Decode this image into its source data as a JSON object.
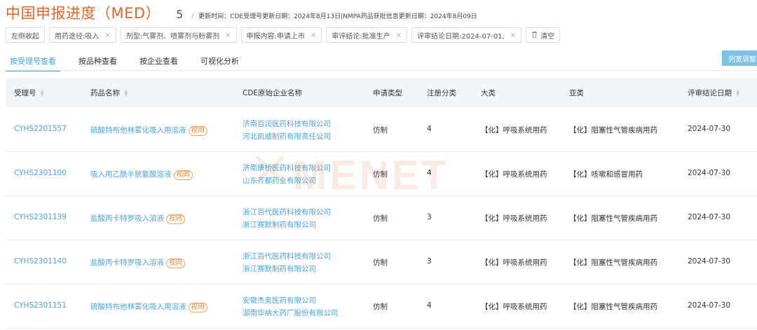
{
  "header": {
    "title": "中国申报进度（MED）",
    "count": "5",
    "separator": "/",
    "update_text": "更新时间：CDE受理号更新日期：2024年8月13日|NMPA药品获批信息更新日期：2024年8月09日"
  },
  "filters": {
    "collapse": "左侧收起",
    "chips": [
      {
        "label": "用药途径:吸入"
      },
      {
        "label": "剂型:气雾剂、喷雾剂与粉雾剂"
      },
      {
        "label": "申报内容:申请上市"
      },
      {
        "label": "审评结论:批准生产"
      },
      {
        "label": "评审结论日期:2024-07-01,"
      }
    ],
    "clear": "清空",
    "close_glyph": "×"
  },
  "tabs": [
    "按受理号查看",
    "按品种查看",
    "按企业查看",
    "可视化分析"
  ],
  "column_adjust_label": "列宽调整",
  "watermark_text": "MENET",
  "table": {
    "headers": {
      "acceptance_no": "受理号",
      "drug_name": "药品名称",
      "company": "CDE原始企业名称",
      "app_type": "申请类型",
      "reg_class": "注册分类",
      "category": "大类",
      "subcategory": "亚类",
      "review_date": "评审结论日期"
    },
    "rows": [
      {
        "acceptance_no": "CYHS2201557",
        "drug_name": "硫酸特布他林雾化吸入用溶液",
        "badge": "视同",
        "companies": [
          "济南百润医药科技有限公司",
          "河北凯威制药有限责任公司"
        ],
        "app_type": "仿制",
        "reg_class": "4",
        "category": "【化】呼吸系统用药",
        "subcategory": "【化】阻塞性气管疾病用药",
        "review_date": "2024-07-30"
      },
      {
        "acceptance_no": "CYHS2301100",
        "drug_name": "吸入用乙酰半胱氨酸溶液",
        "badge": "视同",
        "companies": [
          "济南康桥医药科技有限公司",
          "山东齐都药业有限公司"
        ],
        "app_type": "仿制",
        "reg_class": "4",
        "category": "【化】呼吸系统用药",
        "subcategory": "【化】咳嗽和感冒用药",
        "review_date": "2024-07-30"
      },
      {
        "acceptance_no": "CYHS2301139",
        "drug_name": "盐酸丙卡特罗吸入溶液",
        "badge": "视同",
        "companies": [
          "浙江百代医药科技有限公司",
          "浙江赛默制药有限公司"
        ],
        "app_type": "仿制",
        "reg_class": "3",
        "category": "【化】呼吸系统用药",
        "subcategory": "【化】阻塞性气管疾病用药",
        "review_date": "2024-07-30"
      },
      {
        "acceptance_no": "CYHS2301140",
        "drug_name": "盐酸丙卡特罗吸入溶液",
        "badge": "视同",
        "companies": [
          "浙江百代医药科技有限公司",
          "浙江赛默制药有限公司"
        ],
        "app_type": "仿制",
        "reg_class": "3",
        "category": "【化】呼吸系统用药",
        "subcategory": "【化】阻塞性气管疾病用药",
        "review_date": "2024-07-30"
      },
      {
        "acceptance_no": "CYHS2301151",
        "drug_name": "硫酸特布他林雾化吸入用溶液",
        "badge": "视同",
        "companies": [
          "安徽杰奥医药有限公司",
          "湖南华纳大药厂股份有限公司"
        ],
        "app_type": "仿制",
        "reg_class": "4",
        "category": "【化】呼吸系统用药",
        "subcategory": "【化】阻塞性气管疾病用药",
        "review_date": "2024-07-30"
      }
    ]
  },
  "colors": {
    "title": "#e0682b",
    "link": "#48a6d8",
    "badge": "#f07e1c",
    "active_tab": "#3aa6d6",
    "button": "#7ec1e4"
  }
}
